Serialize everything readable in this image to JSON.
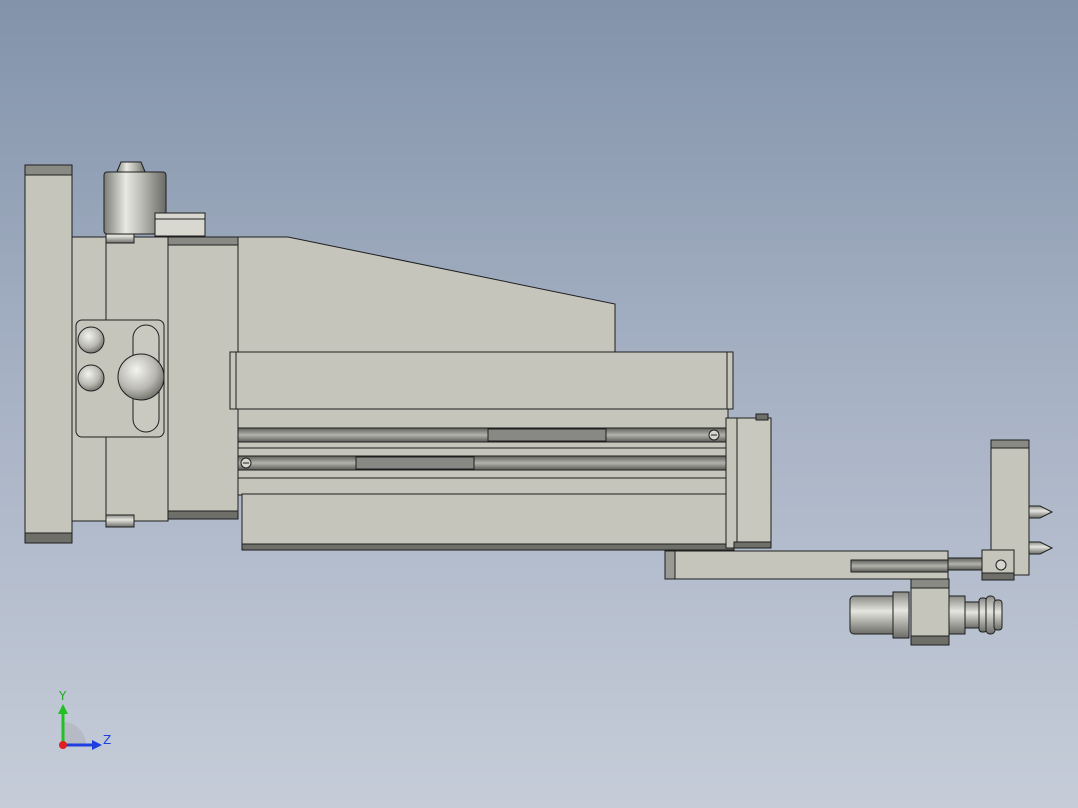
{
  "viewport": {
    "background_top": "#8293aa",
    "background_bottom": "#c6cdd9",
    "part_color": "#c5c5bc",
    "part_shadow": "#6f6f6a",
    "edge_color": "#1e1e1e"
  },
  "triad": {
    "y_label": "Y",
    "z_label": "Z",
    "y_color": "#22c022",
    "z_color": "#1f3fe0",
    "x_color": "#e02020"
  }
}
